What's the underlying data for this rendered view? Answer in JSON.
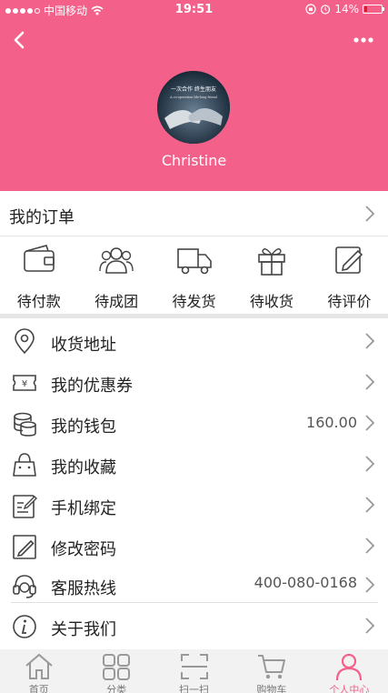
{
  "status_bar": {
    "carrier": "中国移动",
    "time": "19:51",
    "battery_percent": "14%",
    "battery_level": 0.14
  },
  "header": {
    "username": "Christine",
    "avatar_text_top": "一次合作  终生朋友",
    "avatar_text_bottom": "A co-operation life-long friend"
  },
  "orders": {
    "title": "我的订单",
    "statuses": [
      {
        "label": "待付款",
        "icon": "wallet-icon"
      },
      {
        "label": "待成团",
        "icon": "group-icon"
      },
      {
        "label": "待发货",
        "icon": "truck-icon"
      },
      {
        "label": "待收货",
        "icon": "gift-icon"
      },
      {
        "label": "待评价",
        "icon": "review-edit-icon"
      }
    ]
  },
  "menu": [
    {
      "label": "收货地址",
      "value": "",
      "icon": "location-pin-icon"
    },
    {
      "label": "我的优惠券",
      "value": "",
      "icon": "coupon-icon"
    },
    {
      "label": "我的钱包",
      "value": "160.00",
      "icon": "coins-icon"
    },
    {
      "label": "我的收藏",
      "value": "",
      "icon": "bag-icon"
    },
    {
      "label": "手机绑定",
      "value": "",
      "icon": "phone-bind-edit-icon"
    },
    {
      "label": "修改密码",
      "value": "",
      "icon": "password-edit-icon"
    },
    {
      "label": "客服热线",
      "value": "400-080-0168",
      "icon": "headset-icon"
    },
    {
      "label": "关于我们",
      "value": "",
      "icon": "info-icon"
    }
  ],
  "tabs": [
    {
      "label": "首页",
      "icon": "home-icon",
      "active": false
    },
    {
      "label": "分类",
      "icon": "category-grid-icon",
      "active": false
    },
    {
      "label": "扫一扫",
      "icon": "scan-icon",
      "active": false
    },
    {
      "label": "购物车",
      "icon": "cart-icon",
      "active": false
    },
    {
      "label": "个人中心",
      "icon": "user-icon",
      "active": true
    }
  ],
  "colors": {
    "accent": "#f3608a",
    "battery_low": "#e31b1b"
  }
}
